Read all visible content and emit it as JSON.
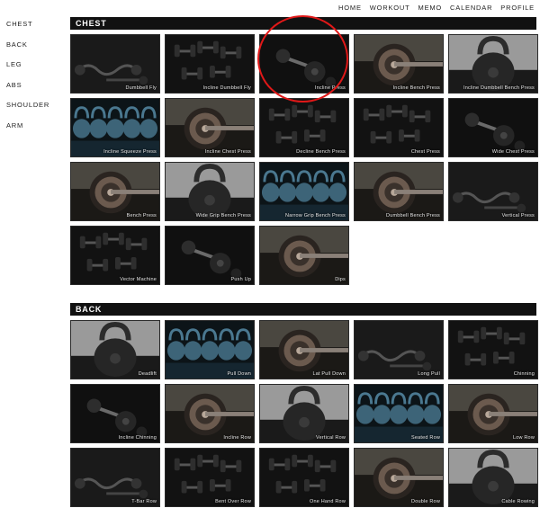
{
  "nav": {
    "items": [
      "HOME",
      "WORKOUT",
      "MEMO",
      "CALENDAR",
      "PROFILE"
    ]
  },
  "sidebar": {
    "items": [
      "CHEST",
      "BACK",
      "LEG",
      "ABS",
      "SHOULDER",
      "ARM"
    ]
  },
  "sections": [
    {
      "title": "CHEST",
      "tiles": [
        {
          "label": "Dumbbell Fly",
          "img": "bars"
        },
        {
          "label": "Incline Dumbbell Fly",
          "img": "dumbbells"
        },
        {
          "label": "Incline Press",
          "img": "dumbbell-dark"
        },
        {
          "label": "Incline Bench Press",
          "img": "plate"
        },
        {
          "label": "Incline Dumbbell Bench Press",
          "img": "kettlebell"
        },
        {
          "label": "Incline Squeeze Press",
          "img": "kettlebells-blue"
        },
        {
          "label": "Incline Chest Press",
          "img": "plate"
        },
        {
          "label": "Decline Bench Press",
          "img": "dumbbells"
        },
        {
          "label": "Chest Press",
          "img": "dumbbells"
        },
        {
          "label": "Wide Chest Press",
          "img": "dumbbell-dark"
        },
        {
          "label": "Bench Press",
          "img": "plate"
        },
        {
          "label": "Wide Grip Bench Press",
          "img": "kettlebell"
        },
        {
          "label": "Narrow Grip Bench Press",
          "img": "kettlebells-blue"
        },
        {
          "label": "Dumbbell Bench Press",
          "img": "plate"
        },
        {
          "label": "Vertical Press",
          "img": "bars"
        },
        {
          "label": "Vector Machine",
          "img": "dumbbells"
        },
        {
          "label": "Push Up",
          "img": "dumbbell-dark"
        },
        {
          "label": "Dips",
          "img": "plate"
        }
      ]
    },
    {
      "title": "BACK",
      "tiles": [
        {
          "label": "Deadlift",
          "img": "kettlebell"
        },
        {
          "label": "Pull Down",
          "img": "kettlebells-blue"
        },
        {
          "label": "Lat Pull Down",
          "img": "plate"
        },
        {
          "label": "Long Pull",
          "img": "bars"
        },
        {
          "label": "Chinning",
          "img": "dumbbells"
        },
        {
          "label": "Incline Chinning",
          "img": "dumbbell-dark"
        },
        {
          "label": "Incline Row",
          "img": "plate"
        },
        {
          "label": "Vertical Row",
          "img": "kettlebell"
        },
        {
          "label": "Seated Row",
          "img": "kettlebells-blue"
        },
        {
          "label": "Low Row",
          "img": "plate"
        },
        {
          "label": "T-Bar Row",
          "img": "bars"
        },
        {
          "label": "Bent Over Row",
          "img": "dumbbells"
        },
        {
          "label": "One Hand Row",
          "img": "dumbbells"
        },
        {
          "label": "Double Row",
          "img": "plate"
        },
        {
          "label": "Cable Rowing",
          "img": "kettlebell"
        }
      ]
    }
  ]
}
